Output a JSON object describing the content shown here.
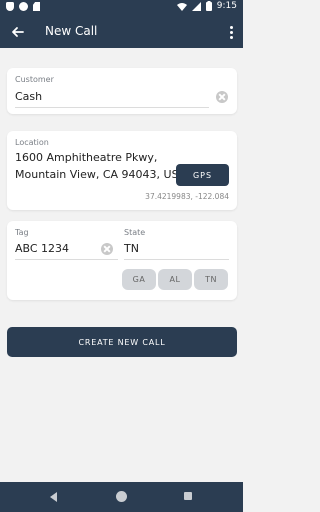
{
  "status_bar": {
    "time": "9:15"
  },
  "app_bar": {
    "title": "New Call"
  },
  "customer": {
    "label": "Customer",
    "value": "Cash"
  },
  "location": {
    "label": "Location",
    "address_line1": "1600 Amphitheatre Pkwy,",
    "address_line2": "Mountain View, CA 94043, USA",
    "gps_label": "GPS",
    "coordinates": "37.4219983, -122.084"
  },
  "tag": {
    "label": "Tag",
    "value": "ABC 1234"
  },
  "state": {
    "label": "State",
    "value": "TN",
    "options": [
      "GA",
      "AL",
      "TN"
    ]
  },
  "actions": {
    "create_label": "CREATE NEW CALL"
  },
  "colors": {
    "primary": "#2b3d52",
    "background": "#f2f2f2",
    "chip": "#d3d6da"
  }
}
